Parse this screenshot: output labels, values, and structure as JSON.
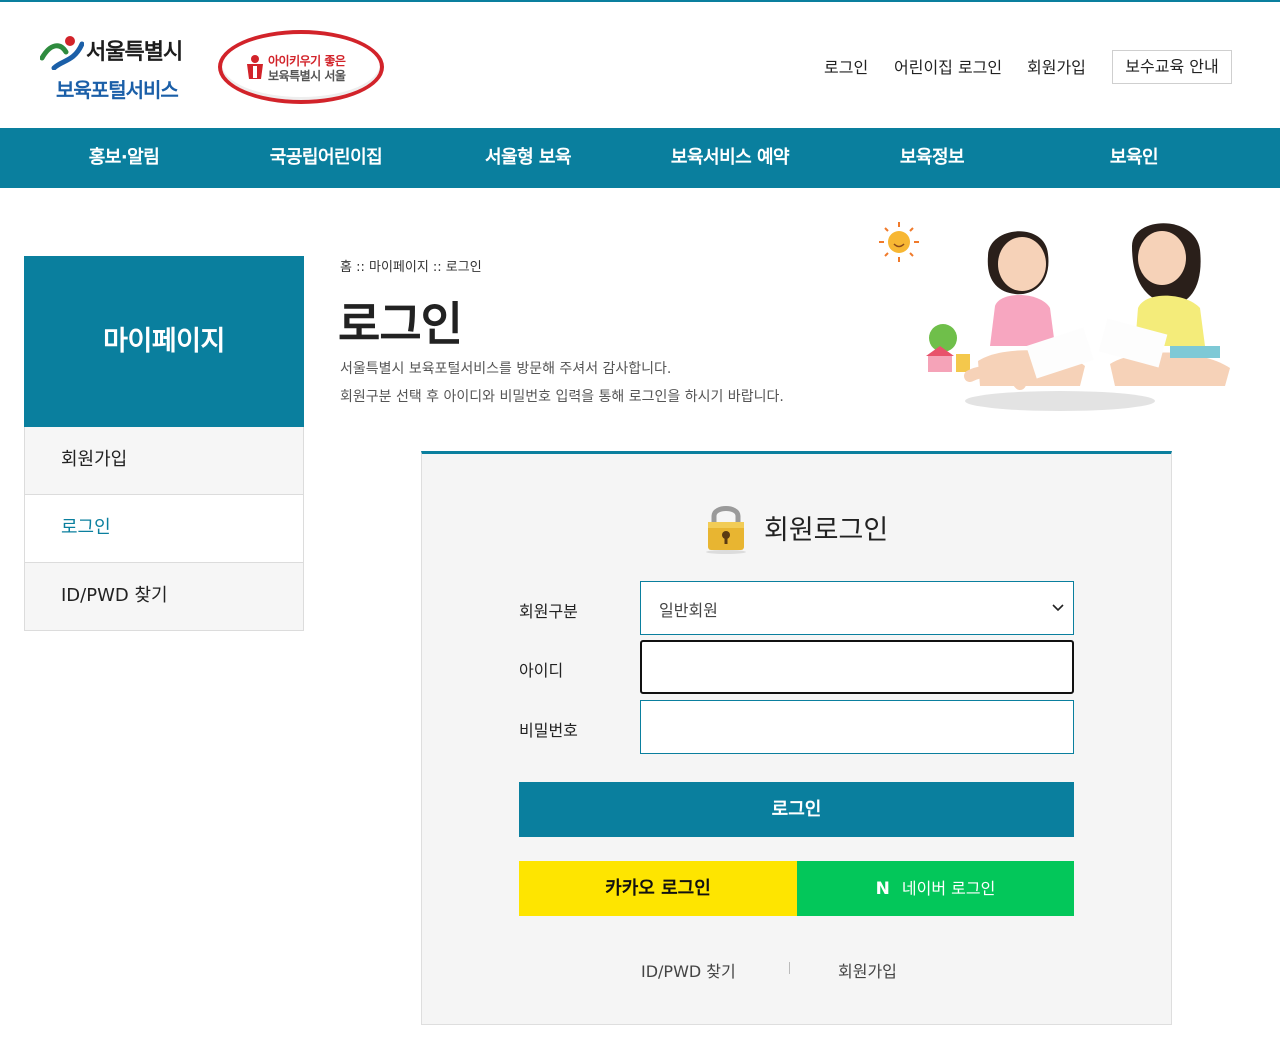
{
  "header": {
    "logo_line1": "서울특별시",
    "logo_line2": "보육포털서비스",
    "badge_line1": "아이키우기 좋은",
    "badge_line2": "보육특별시 서울",
    "util": {
      "login": "로그인",
      "daycare_login": "어린이집 로그인",
      "signup": "회원가입",
      "training": "보수교육 안내"
    }
  },
  "gnb": [
    "홍보·알림",
    "국공립어린이집",
    "서울형 보육",
    "보육서비스 예약",
    "보육정보",
    "보육인"
  ],
  "side": {
    "title": "마이페이지",
    "items": [
      "회원가입",
      "로그인",
      "ID/PWD 찾기"
    ]
  },
  "page": {
    "breadcrumb": "홈 :: 마이페이지 :: 로그인",
    "title": "로그인",
    "desc1": "서울특별시 보육포털서비스를 방문해 주셔서 감사합니다.",
    "desc2": "회원구분 선택 후 아이디와 비밀번호 입력을 통해 로그인을 하시기 바랍니다."
  },
  "login": {
    "title": "회원로그인",
    "member_type_label": "회원구분",
    "member_type_value": "일반회원",
    "id_label": "아이디",
    "id_value": "",
    "pw_label": "비밀번호",
    "pw_value": "",
    "submit": "로그인",
    "kakao": "카카오 로그인",
    "naver_mark": "N",
    "naver": "네이버 로그인",
    "find": "ID/PWD 찾기",
    "signup": "회원가입"
  },
  "colors": {
    "primary": "#0a7f9e",
    "kakao": "#fee500",
    "naver": "#03c75a",
    "badge_red": "#d2232a"
  }
}
